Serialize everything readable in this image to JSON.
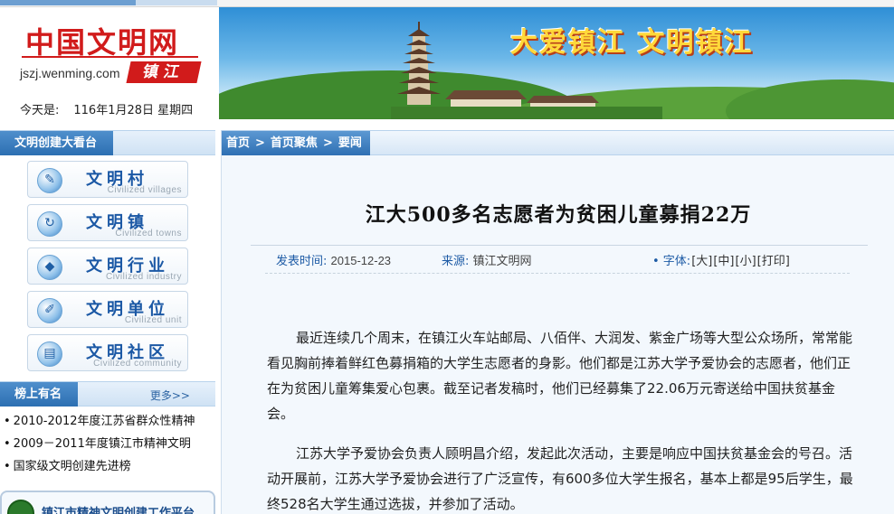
{
  "header": {
    "logo_cn": "中国文明网",
    "logo_domain": "jszj.wenming.com",
    "logo_city": "镇江",
    "today_label": "今天是:",
    "today_value": "116年1月28日 星期四",
    "banner_slogan": "大爱镇江  文明镇江"
  },
  "sidebar": {
    "section_title": "文明创建大看台",
    "nav": [
      {
        "cn": "文明村",
        "en": "Civilized villages",
        "icon": "broom-icon"
      },
      {
        "cn": "文明镇",
        "en": "Civilized towns",
        "icon": "globe-icon"
      },
      {
        "cn": "文明行业",
        "en": "Civilized industry",
        "icon": "diamond-icon"
      },
      {
        "cn": "文明单位",
        "en": "Civilized unit",
        "icon": "document-icon"
      },
      {
        "cn": "文明社区",
        "en": "Civilized community",
        "icon": "folder-icon"
      }
    ],
    "ranking_title": "榜上有名",
    "ranking_more": "更多>>",
    "ranking_items": [
      "2010-2012年度江苏省群众性精神",
      "2009－2011年度镇江市精神文明",
      "国家级文明创建先进榜"
    ],
    "platform_text": "镇江市精神文明创建工作平台"
  },
  "breadcrumb": {
    "home": "首页",
    "section": "首页聚焦",
    "current": "要闻",
    "separator": ">"
  },
  "article": {
    "title": "江大500多名志愿者为贫困儿童募捐22万",
    "date_label": "发表时间:",
    "date_value": "2015-12-23",
    "source_label": "来源:",
    "source_value": "镇江文明网",
    "font_label": "• 字体:",
    "font_large": "[大]",
    "font_medium": "[中]",
    "font_small": "[小]",
    "print": "[打印]",
    "paragraphs": [
      "最近连续几个周末，在镇江火车站邮局、八佰伴、大润发、紫金广场等大型公众场所，常常能看见胸前捧着鲜红色募捐箱的大学生志愿者的身影。他们都是江苏大学予爱协会的志愿者，他们正在为贫困儿童筹集爱心包裹。截至记者发稿时，他们已经募集了22.06万元寄送给中国扶贫基金会。",
      "江苏大学予爱协会负责人顾明昌介绍，发起此次活动，主要是响应中国扶贫基金会的号召。活动开展前，江苏大学予爱协会进行了广泛宣传，有600多位大学生报名，基本上都是95后学生，最终528名大学生通过选拔，并参加了活动。"
    ]
  },
  "colors": {
    "brand_red": "#d11b1b",
    "nav_blue": "#1b58a5",
    "header_blue": "#2c6fb2"
  }
}
